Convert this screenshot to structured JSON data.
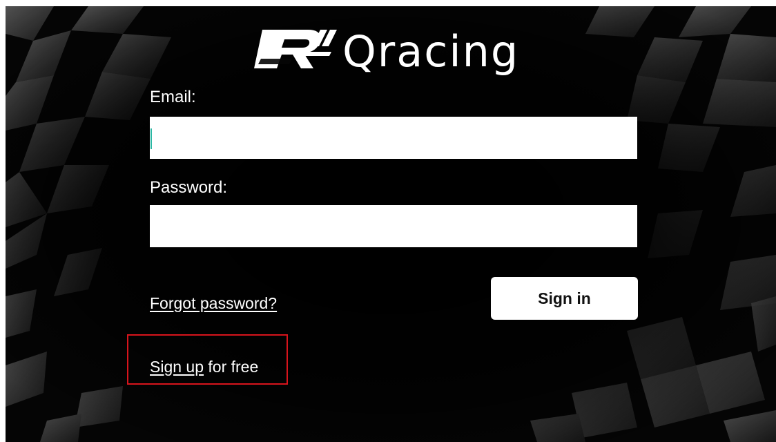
{
  "brand": {
    "name": "Qracing",
    "logo_mark": "R"
  },
  "form": {
    "email": {
      "label": "Email:",
      "value": "",
      "placeholder": ""
    },
    "password": {
      "label": "Password:",
      "value": "",
      "placeholder": ""
    },
    "forgot_link": "Forgot password?",
    "sign_in_label": "Sign in"
  },
  "signup": {
    "link_text": "Sign up",
    "suffix": "for free"
  },
  "colors": {
    "background": "#050505",
    "text": "#ffffff",
    "field_bg": "#ffffff",
    "caret": "#2bb7a4",
    "highlight": "#d8141c"
  }
}
